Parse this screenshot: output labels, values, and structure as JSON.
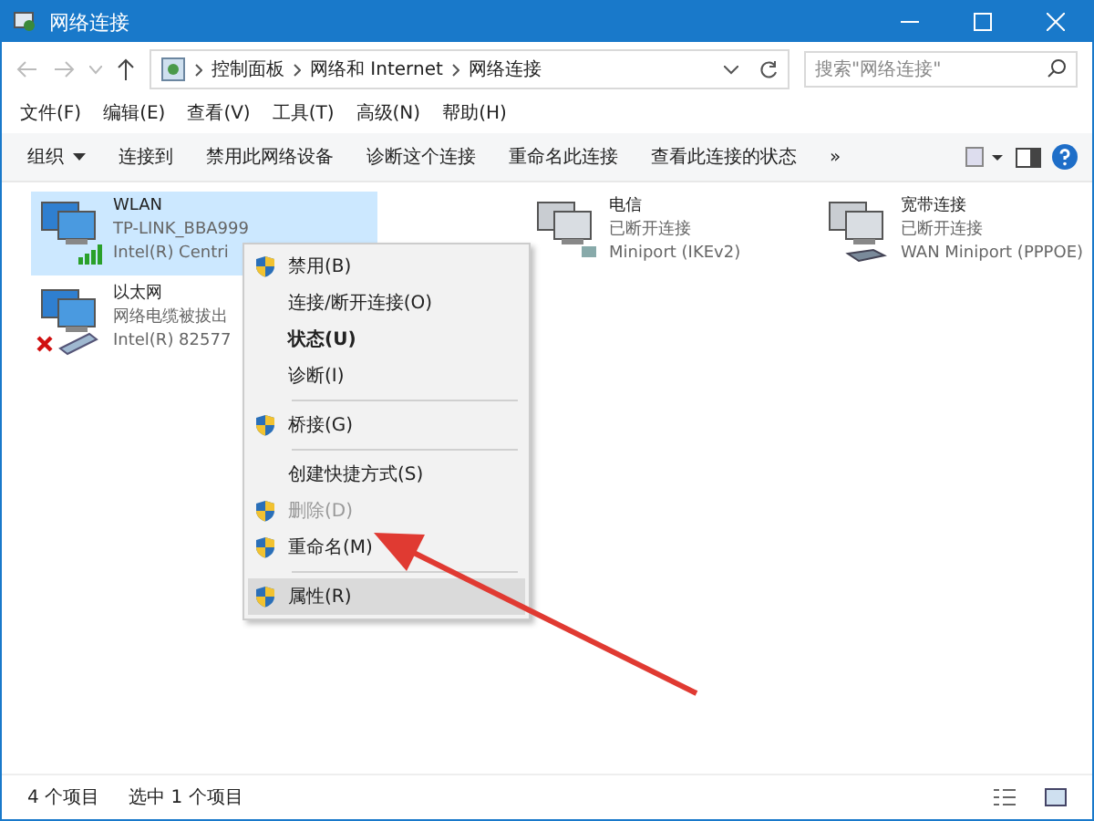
{
  "window": {
    "title": "网络连接"
  },
  "breadcrumb": [
    "控制面板",
    "网络和 Internet",
    "网络连接"
  ],
  "search": {
    "placeholder": "搜索\"网络连接\""
  },
  "menu_bar": [
    "文件(F)",
    "编辑(E)",
    "查看(V)",
    "工具(T)",
    "高级(N)",
    "帮助(H)"
  ],
  "toolbar": [
    {
      "label": "组织",
      "dropdown": true
    },
    {
      "label": "连接到",
      "dropdown": false
    },
    {
      "label": "禁用此网络设备",
      "dropdown": false
    },
    {
      "label": "诊断这个连接",
      "dropdown": false
    },
    {
      "label": "重命名此连接",
      "dropdown": false
    },
    {
      "label": "查看此连接的状态",
      "dropdown": false
    },
    {
      "label": "»",
      "dropdown": false
    }
  ],
  "connections": [
    {
      "name": "WLAN",
      "status": "TP-LINK_BBA999",
      "device": "Intel(R) Centri",
      "kind": "wifi",
      "selected": true,
      "disconnected": false
    },
    {
      "name": "电信",
      "status": "已断开连接",
      "device": "Miniport (IKEv2)",
      "kind": "vpn",
      "selected": false,
      "disconnected": false
    },
    {
      "name": "宽带连接",
      "status": "已断开连接",
      "device": "WAN Miniport (PPPOE)",
      "kind": "dialup",
      "selected": false,
      "disconnected": false
    },
    {
      "name": "以太网",
      "status": "网络电缆被拔出",
      "device": "Intel(R) 82577",
      "kind": "ethernet",
      "selected": false,
      "disconnected": true
    }
  ],
  "context_menu": [
    {
      "kind": "item",
      "label": "禁用(B)",
      "shield": true,
      "bold": false,
      "disabled": false,
      "selected": false
    },
    {
      "kind": "item",
      "label": "连接/断开连接(O)",
      "shield": false,
      "bold": false,
      "disabled": false,
      "selected": false
    },
    {
      "kind": "item",
      "label": "状态(U)",
      "shield": false,
      "bold": true,
      "disabled": false,
      "selected": false
    },
    {
      "kind": "item",
      "label": "诊断(I)",
      "shield": false,
      "bold": false,
      "disabled": false,
      "selected": false
    },
    {
      "kind": "separator"
    },
    {
      "kind": "item",
      "label": "桥接(G)",
      "shield": true,
      "bold": false,
      "disabled": false,
      "selected": false
    },
    {
      "kind": "separator"
    },
    {
      "kind": "item",
      "label": "创建快捷方式(S)",
      "shield": false,
      "bold": false,
      "disabled": false,
      "selected": false
    },
    {
      "kind": "item",
      "label": "删除(D)",
      "shield": true,
      "bold": false,
      "disabled": true,
      "selected": false
    },
    {
      "kind": "item",
      "label": "重命名(M)",
      "shield": true,
      "bold": false,
      "disabled": false,
      "selected": false
    },
    {
      "kind": "separator"
    },
    {
      "kind": "item",
      "label": "属性(R)",
      "shield": true,
      "bold": false,
      "disabled": false,
      "selected": true
    }
  ],
  "status_bar": {
    "count": "4 个项目",
    "selection": "选中 1 个项目"
  }
}
